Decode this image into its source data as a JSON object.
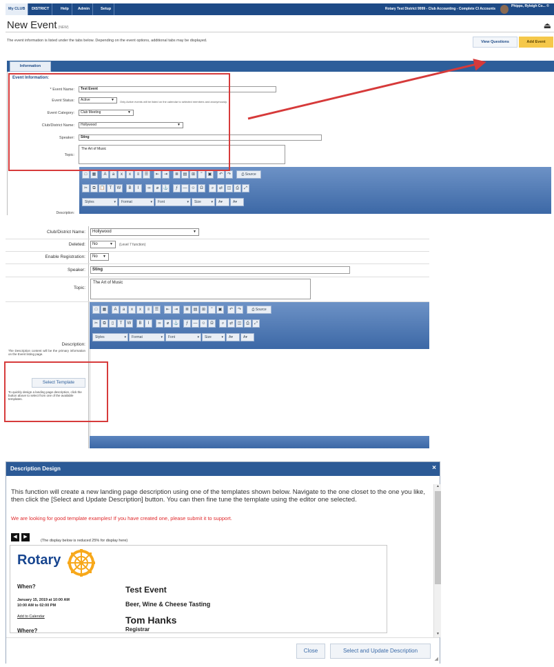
{
  "panel1": {
    "tabs": [
      "My CLUB",
      "DISTRICT",
      "Help",
      "Admin",
      "Setup"
    ],
    "org": "Rotary Test District 9999 - Club Accounting - Complete CI Accounts",
    "user": "Phipps, Ryleigh Co... ©",
    "page_title": "New Event",
    "page_title_tag": "(NEW)",
    "info_text": "The event information is listed under the tabs below. Depending on the event options, additional tabs may be displayed.",
    "view_questions": "View Questions",
    "add_event": "Add Event",
    "info_tab": "Information",
    "section": "Event Information:",
    "fields": {
      "event_name_label": "* Event Name:",
      "event_name_value": "Test Event",
      "status_label": "Event Status:",
      "status_value": "Active",
      "status_hint": "Only Active events will be listed on the calendar to selected members and anonymously.",
      "category_label": "Event Category:",
      "category_value": "Club Meeting",
      "club_label": "Club/District Name:",
      "club_value": "Hollywood",
      "speaker_label": "Speaker:",
      "speaker_value": "Sting",
      "topic_label": "Topic:",
      "topic_value": "The Art of Music",
      "description_label": "Description:"
    },
    "toolbar": {
      "source": "Source",
      "styles": "Styles",
      "format": "Format",
      "font": "Font",
      "size": "Size"
    }
  },
  "panel2": {
    "club_label": "Club/District Name:",
    "club_value": "Hollywood",
    "deleted_label": "Deleted:",
    "deleted_value": "No",
    "deleted_hint": "(Level 7 function)",
    "reg_label": "Enable Registration:",
    "reg_value": "No",
    "speaker_label": "Speaker:",
    "speaker_value": "Sting",
    "topic_label": "Topic:",
    "topic_value": "The Art of Music",
    "description_label": "Description:",
    "description_note": "The Description content will be the primary information on the Event listing page.",
    "template_button": "Select Template",
    "template_note": "To quickly design a landing page description, click the button above to select from one of the available templates.",
    "toolbar": {
      "source": "Source",
      "styles": "Styles",
      "format": "Format",
      "font": "Font",
      "size": "Size"
    }
  },
  "dialog": {
    "title": "Description Design",
    "close_glyph": "×",
    "intro": "This function will create a new landing page description using one of the templates shown below. Navigate to the one closet to the one you like, then click the [Select and Update Description] button. You can then fine tune the template using the editor one selected.",
    "red_note": "We are looking for good template examples! If you have created one, please submit it to support.",
    "prev_glyph": "◀",
    "next_glyph": "▶",
    "reduced_note": "(The display below is reduced 25% for display here)",
    "preview": {
      "logo_text": "Rotary",
      "when_label": "When?",
      "when_value": "January 15, 2019 at 10:00 AM",
      "when_value2": "10:00 AM to 02:00 PM",
      "add_to_calendar": "Add to Calendar",
      "where_label": "Where?",
      "event_title": "Test Event",
      "event_subtitle": "Beer, Wine & Cheese Tasting",
      "contact_name": "Tom Hanks",
      "contact_role": "Registrar"
    },
    "close_button": "Close",
    "select_button": "Select and Update Description"
  },
  "colors": {
    "nav_blue": "#1d4a86",
    "accent_yellow": "#f5c84a",
    "highlight_red": "#d63a3a",
    "rotary_blue": "#17458f",
    "rotary_gold": "#f7a81b"
  }
}
